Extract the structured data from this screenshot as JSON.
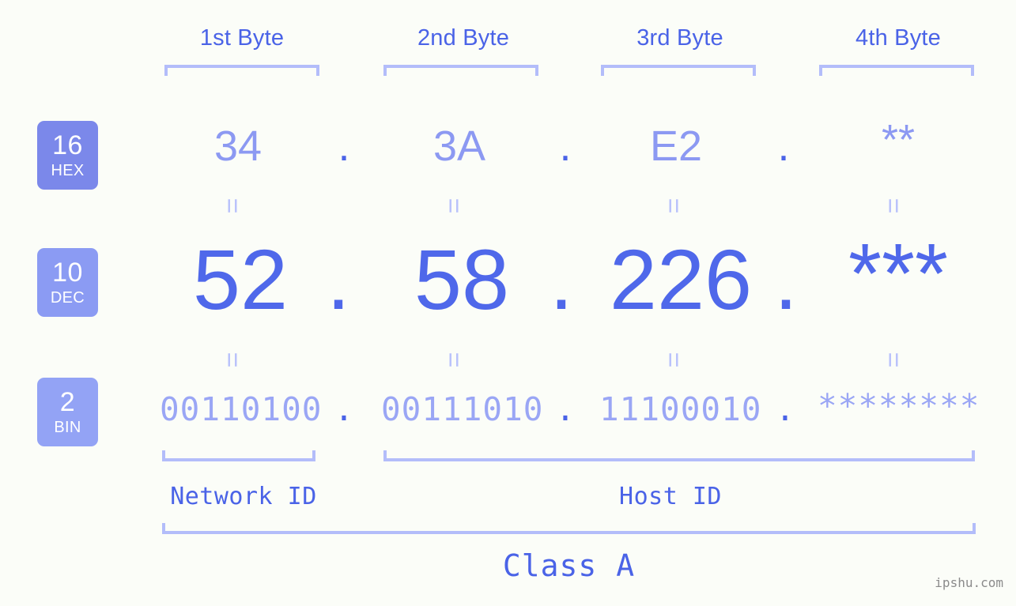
{
  "canvas": {
    "background": "#fbfdf8",
    "accent": "#4a63e7",
    "accent_light": "#b3bdfa",
    "badge_dark": "#7b88ea",
    "badge_light": "#93a3f5"
  },
  "byte_headers": [
    {
      "label": "1st Byte"
    },
    {
      "label": "2nd Byte"
    },
    {
      "label": "3rd Byte"
    },
    {
      "label": "4th Byte"
    }
  ],
  "bases": [
    {
      "number": "16",
      "name": "HEX",
      "color": "#7b88ea"
    },
    {
      "number": "10",
      "name": "DEC",
      "color": "#8b9bf3"
    },
    {
      "number": "2",
      "name": "BIN",
      "color": "#93a3f5"
    }
  ],
  "rows": {
    "hex": {
      "base_number": "16",
      "base_name": "HEX",
      "values": [
        "34",
        "3A",
        "E2",
        "**"
      ],
      "separator": "."
    },
    "dec": {
      "base_number": "10",
      "base_name": "DEC",
      "values": [
        "52",
        "58",
        "226",
        "***"
      ],
      "separator": "."
    },
    "bin": {
      "base_number": "2",
      "base_name": "BIN",
      "values": [
        "00110100",
        "00111010",
        "11100010",
        "********"
      ],
      "separator": "."
    }
  },
  "equals_marks": {
    "glyph": "=",
    "count_per_row": 4
  },
  "id_labels": [
    {
      "label": "Network ID"
    },
    {
      "label": "Host ID"
    }
  ],
  "class_label": "Class A",
  "watermark": "ipshu.com"
}
